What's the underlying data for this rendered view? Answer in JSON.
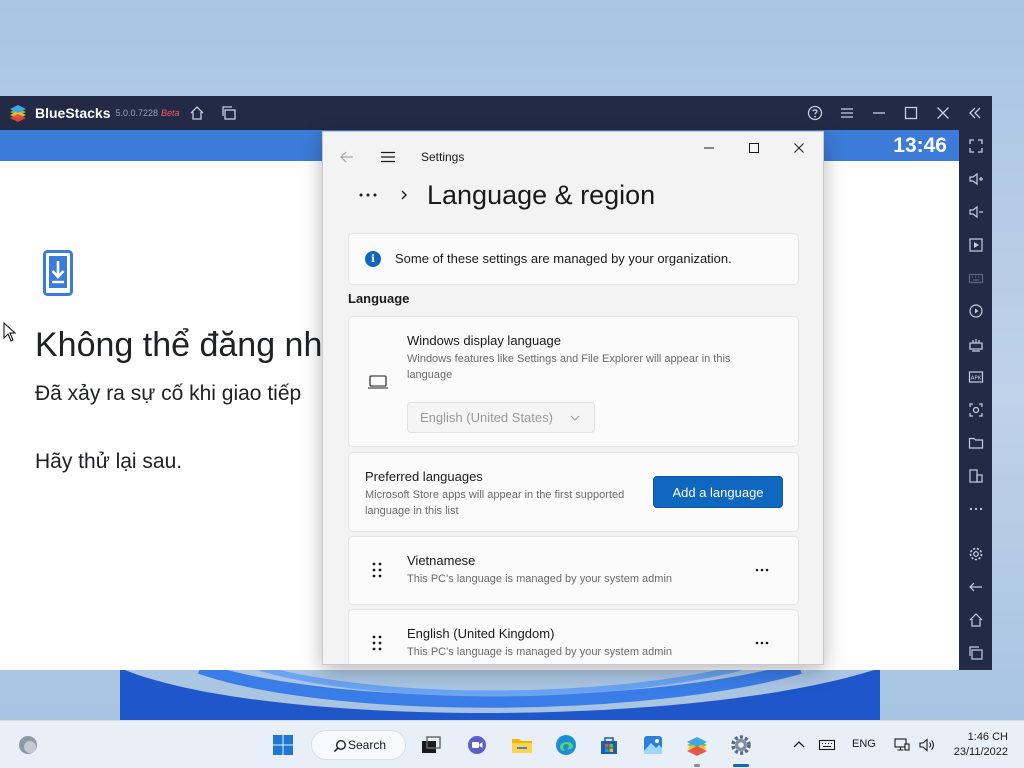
{
  "bluestacks": {
    "app_name": "BlueStacks",
    "version": "5.0.0.7228",
    "beta_label": "Beta",
    "icons": [
      "home-icon",
      "multi-instance-icon",
      "help-icon",
      "menu-icon",
      "minimize-icon",
      "maximize-icon",
      "close-icon",
      "collapse-sidebar-icon"
    ],
    "sidebar_icons": [
      "fullscreen-icon",
      "volume-up-icon",
      "volume-down-icon",
      "media-manager-icon",
      "keyboard-controls-icon",
      "macro-recorder-icon",
      "game-controls-icon",
      "install-apk-icon",
      "screenshot-icon",
      "folder-icon",
      "multi-instance-sync-icon",
      "more-icon",
      "settings-icon",
      "back-icon",
      "home-icon",
      "recent-apps-icon"
    ]
  },
  "android": {
    "clock": "13:46",
    "title": "Không thể đăng nh",
    "message": "Đã xảy ra sự cố khi giao tiếp",
    "retry": "Hãy thử lại sau."
  },
  "settings": {
    "app_title": "Settings",
    "page_title": "Language & region",
    "info_banner": "Some of these settings are managed by your organization.",
    "section_label": "Language",
    "display_language": {
      "title": "Windows display language",
      "description": "Windows features like Settings and File Explorer will appear in this language",
      "selected": "English (United States)"
    },
    "preferred": {
      "title": "Preferred languages",
      "description": "Microsoft Store apps will appear in the first supported language in this list",
      "button": "Add a language"
    },
    "languages": [
      {
        "name": "Vietnamese",
        "note": "This PC's language is managed by your system admin"
      },
      {
        "name": "English (United Kingdom)",
        "note": "This PC's language is managed by your system admin"
      }
    ]
  },
  "taskbar": {
    "search_label": "Search",
    "language": "ENG",
    "time": "1:46 CH",
    "date": "23/11/2022"
  },
  "colors": {
    "accent": "#0f67c0",
    "bluestacks_chrome": "#222a45",
    "android_status": "#3d7bd8"
  }
}
